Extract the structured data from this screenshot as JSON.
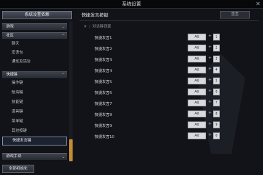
{
  "window": {
    "title": "系统设置",
    "close_glyph": "✕"
  },
  "sidebar": {
    "header": "系统设置依赖",
    "categories": [
      {
        "label": "游戏",
        "expanded": false
      },
      {
        "label": "社区",
        "expanded": true,
        "children": [
          "聊天",
          "宏语句",
          "通知及活动"
        ]
      },
      {
        "label": "快捷键",
        "expanded": true,
        "children": [
          "操作键",
          "航海键",
          "技能键",
          "道具键",
          "菜单键",
          "其他按键",
          "快捷发言键"
        ]
      },
      {
        "label": "游戏手柄",
        "expanded": false
      }
    ],
    "selected": "快捷发言键",
    "reset_label": "全部初始化"
  },
  "main": {
    "heading": "快捷发言按键",
    "default_label": "重置",
    "chat_option": "对话键设置",
    "rows": [
      {
        "label": "快捷发言1",
        "modifier": "Alt",
        "key": "1"
      },
      {
        "label": "快捷发言2",
        "modifier": "Alt",
        "key": "2"
      },
      {
        "label": "快捷发言3",
        "modifier": "Alt",
        "key": "3"
      },
      {
        "label": "快捷发言4",
        "modifier": "Alt",
        "key": "4"
      },
      {
        "label": "快捷发言5",
        "modifier": "Alt",
        "key": "5"
      },
      {
        "label": "快捷发言6",
        "modifier": "Alt",
        "key": "6"
      },
      {
        "label": "快捷发言7",
        "modifier": "Alt",
        "key": "7"
      },
      {
        "label": "快捷发言8",
        "modifier": "Alt",
        "key": "8"
      },
      {
        "label": "快捷发言9",
        "modifier": "Alt",
        "key": "9"
      },
      {
        "label": "快捷发言10",
        "modifier": "Alt",
        "key": "0"
      }
    ]
  }
}
